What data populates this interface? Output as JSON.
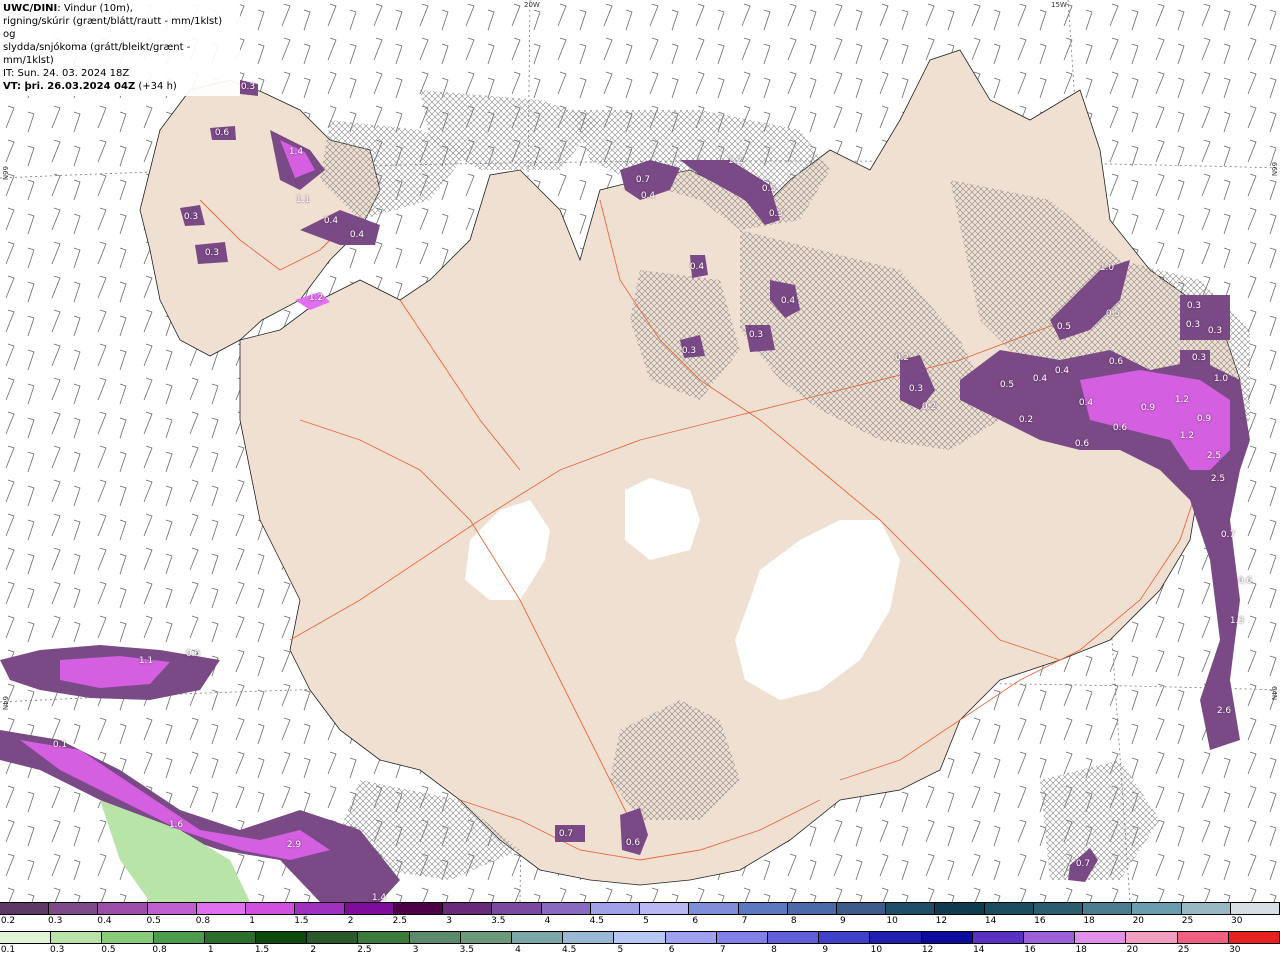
{
  "info": {
    "model": "UWC/DINI",
    "desc1": ": Vindur (10m),",
    "desc2": "rigning/skúrir (grænt/blátt/rautt - mm/1klst) og",
    "desc3": "slydda/snjókoma (grátt/bleikt/grænt - mm/1klst)",
    "it": "IT: Sun. 24. 03. 2024 18Z",
    "vt_label": "VT: þri. 26.03.2024 04Z",
    "vt_offset": " (+34 h)"
  },
  "coords": [
    "20W",
    "15W",
    "66N",
    "66N",
    "64N",
    "64N"
  ],
  "precip_labels": [
    "0.3",
    "0.6",
    "1.4",
    "0.3",
    "0.3",
    "0.4",
    "0.4",
    "1.1",
    "1.2",
    "0.7",
    "0.4",
    "1.2",
    "0.5",
    "0.3",
    "0.4",
    "0.4",
    "0.3",
    "0.3",
    "0.2",
    "0.3",
    "0.2",
    "1.0",
    "0.5",
    "0.5",
    "0.3",
    "0.3",
    "0.3",
    "0.3",
    "0.5",
    "0.4",
    "0.4",
    "0.6",
    "1.0",
    "0.2",
    "0.4",
    "0.6",
    "0.6",
    "0.9",
    "1.2",
    "0.9",
    "1.2",
    "2.5",
    "2.5",
    "0.7",
    "0.6",
    "1.3",
    "2.6",
    "1.1",
    "0.6",
    "0.1",
    "1.6",
    "2.9",
    "1.4",
    "0.7",
    "0.6",
    "0.7"
  ],
  "snow_scale": {
    "labels": [
      "0.2",
      "0.3",
      "0.4",
      "0.5",
      "0.8",
      "1",
      "1.5",
      "2",
      "2.5",
      "3",
      "3.5",
      "4",
      "4.5",
      "5",
      "6",
      "7",
      "8",
      "9",
      "10",
      "12",
      "14",
      "16",
      "18",
      "20",
      "25",
      "30"
    ],
    "colors": [
      "#5d3a66",
      "#7e4a8a",
      "#9c4fa8",
      "#c060d0",
      "#e070f0",
      "#d050e0",
      "#a030c0",
      "#800c9c",
      "#4c0048",
      "#6a2a7a",
      "#7a4aa0",
      "#8a6ac0",
      "#a0a0e8",
      "#b8b8f4",
      "#7e8ed8",
      "#5c78c0",
      "#4a6aa8",
      "#3c5a8a",
      "#1e4e68",
      "#0e3c4e",
      "#1a4e5e",
      "#2a5e6e",
      "#4a7e8e",
      "#6a9eae",
      "#9ab8c4",
      "#d6e0e4"
    ]
  },
  "rain_scale": {
    "labels": [
      "0.1",
      "0.3",
      "0.5",
      "0.8",
      "1",
      "1.5",
      "2",
      "2.5",
      "3",
      "3.5",
      "4",
      "4.5",
      "5",
      "6",
      "7",
      "8",
      "9",
      "10",
      "12",
      "14",
      "16",
      "18",
      "20",
      "25",
      "30"
    ],
    "colors": [
      "#e0f4d8",
      "#b8e4a8",
      "#88cc7c",
      "#4c9c4c",
      "#2c6e2c",
      "#0e4a0e",
      "#2a5a2a",
      "#3c7a3c",
      "#5a8a6a",
      "#6a9a7a",
      "#7aa8a8",
      "#9ab8d4",
      "#b8c8f4",
      "#a0a0f0",
      "#8080e8",
      "#6060d8",
      "#4040c8",
      "#2020b0",
      "#0c0c9c",
      "#5a30c0",
      "#9a60d8",
      "#e090e8",
      "#f0a0c0",
      "#f06080",
      "#e82020"
    ]
  }
}
